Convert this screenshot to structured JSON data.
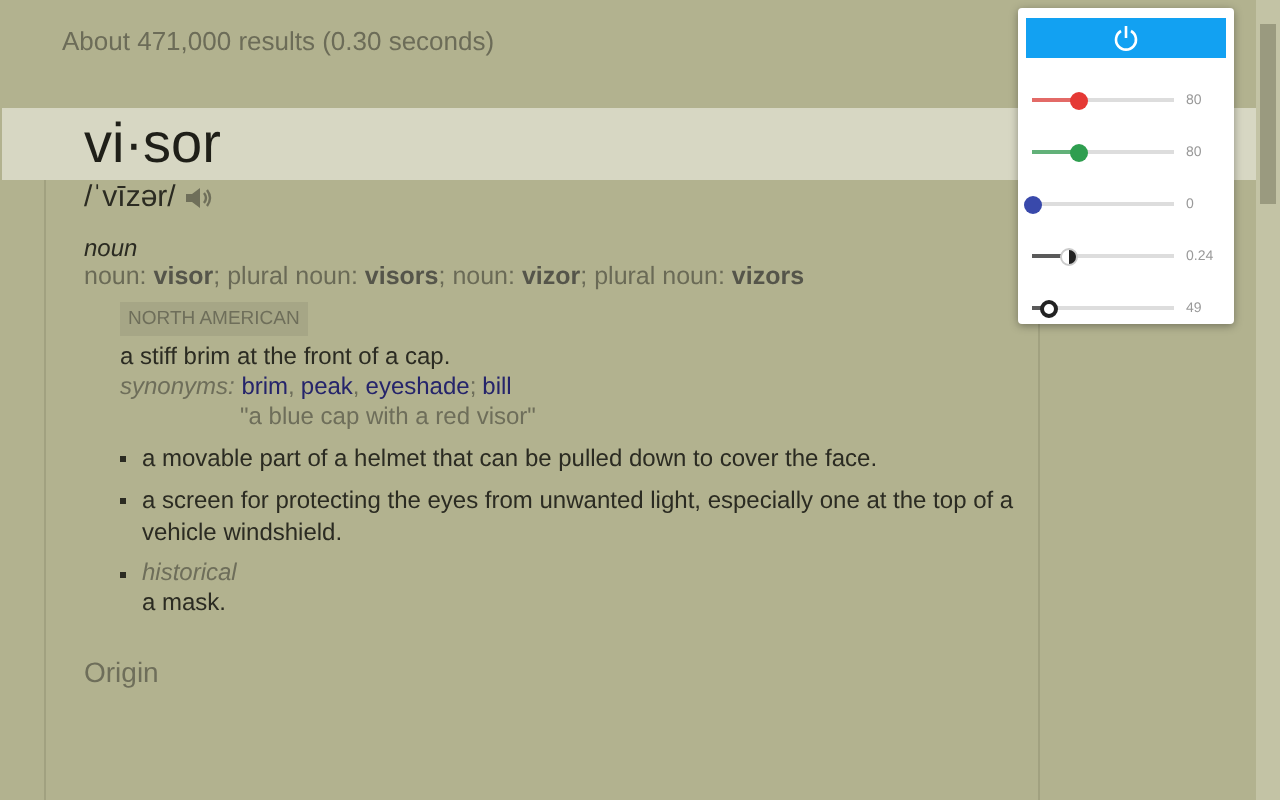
{
  "results_stats": "About 471,000 results (0.30 seconds)",
  "entry": {
    "headword": "vi·sor",
    "pronunciation": "/ˈvīzər/",
    "part_of_speech": "noun",
    "forms": "noun: **visor**; plural noun: **visors**; noun: **vizor**; plural noun: **vizors**",
    "senses": [
      {
        "kind": "tagged",
        "tag": "NORTH AMERICAN",
        "definition": "a stiff brim at the front of a cap.",
        "synonyms_label": "synonyms:",
        "synonyms": [
          {
            "word": "brim",
            "sep": ","
          },
          {
            "word": "peak",
            "sep": ","
          },
          {
            "word": "eyeshade",
            "sep": ";"
          },
          {
            "word": "bill"
          }
        ],
        "example": "\"a blue cap with a red visor\""
      },
      {
        "kind": "plain",
        "definition": "a movable part of a helmet that can be pulled down to cover the face."
      },
      {
        "kind": "plain",
        "definition": "a screen for protecting the eyes from unwanted light, especially one at the top of a vehicle windshield."
      },
      {
        "kind": "labeled",
        "label": "historical",
        "definition": "a mask."
      }
    ],
    "origin_heading": "Origin"
  },
  "popup": {
    "power": {
      "on": true
    },
    "sliders": [
      {
        "kind": "solid",
        "color": "#e53935",
        "level": 0.33,
        "reading": "80"
      },
      {
        "kind": "solid",
        "color": "#2e9e4f",
        "level": 0.33,
        "reading": "80"
      },
      {
        "kind": "solid",
        "color": "#3949ab",
        "level": 0,
        "reading": "0"
      },
      {
        "kind": "half",
        "color": "#222222",
        "level": 0.26,
        "reading": "0.24"
      },
      {
        "kind": "ring",
        "color": "#222222",
        "level": 0.12,
        "reading": "49"
      }
    ]
  }
}
